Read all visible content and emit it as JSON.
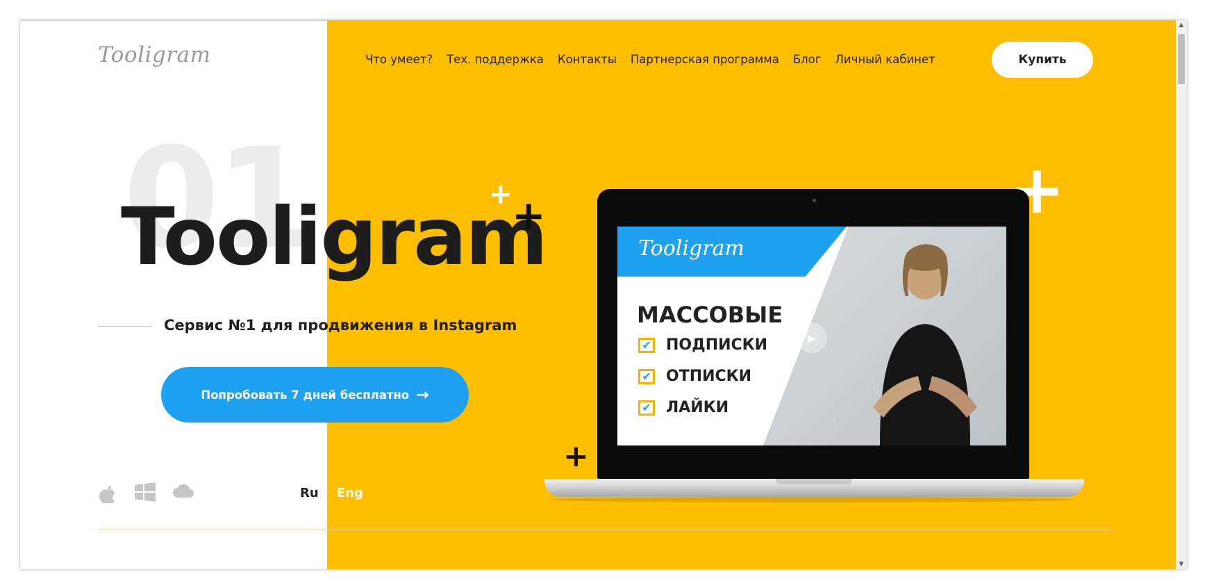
{
  "logo": "Tooligram",
  "nav": [
    "Что умеет?",
    "Тех. поддержка",
    "Контакты",
    "Партнерская программа",
    "Блог",
    "Личный кабинет"
  ],
  "buy_label": "Купить",
  "bg_number": "01",
  "brand": "Tooligram",
  "tagline": "Сервис №1 для продвижения в Instagram",
  "try_label": "Попробовать 7 дней бесплатно",
  "lang": {
    "ru": "Ru",
    "eng": "Eng"
  },
  "video": {
    "logo": "Tooligram",
    "heading": "МАССОВЫЕ",
    "items": [
      "ПОДПИСКИ",
      "ОТПИСКИ",
      "ЛАЙКИ"
    ]
  },
  "colors": {
    "yellow": "#FFBF00",
    "blue": "#1FA1F1",
    "dark": "#1d1d1d"
  },
  "icons": [
    "apple-icon",
    "windows-icon",
    "cloud-icon",
    "play-icon",
    "arrow-right-icon",
    "plus-icon"
  ]
}
